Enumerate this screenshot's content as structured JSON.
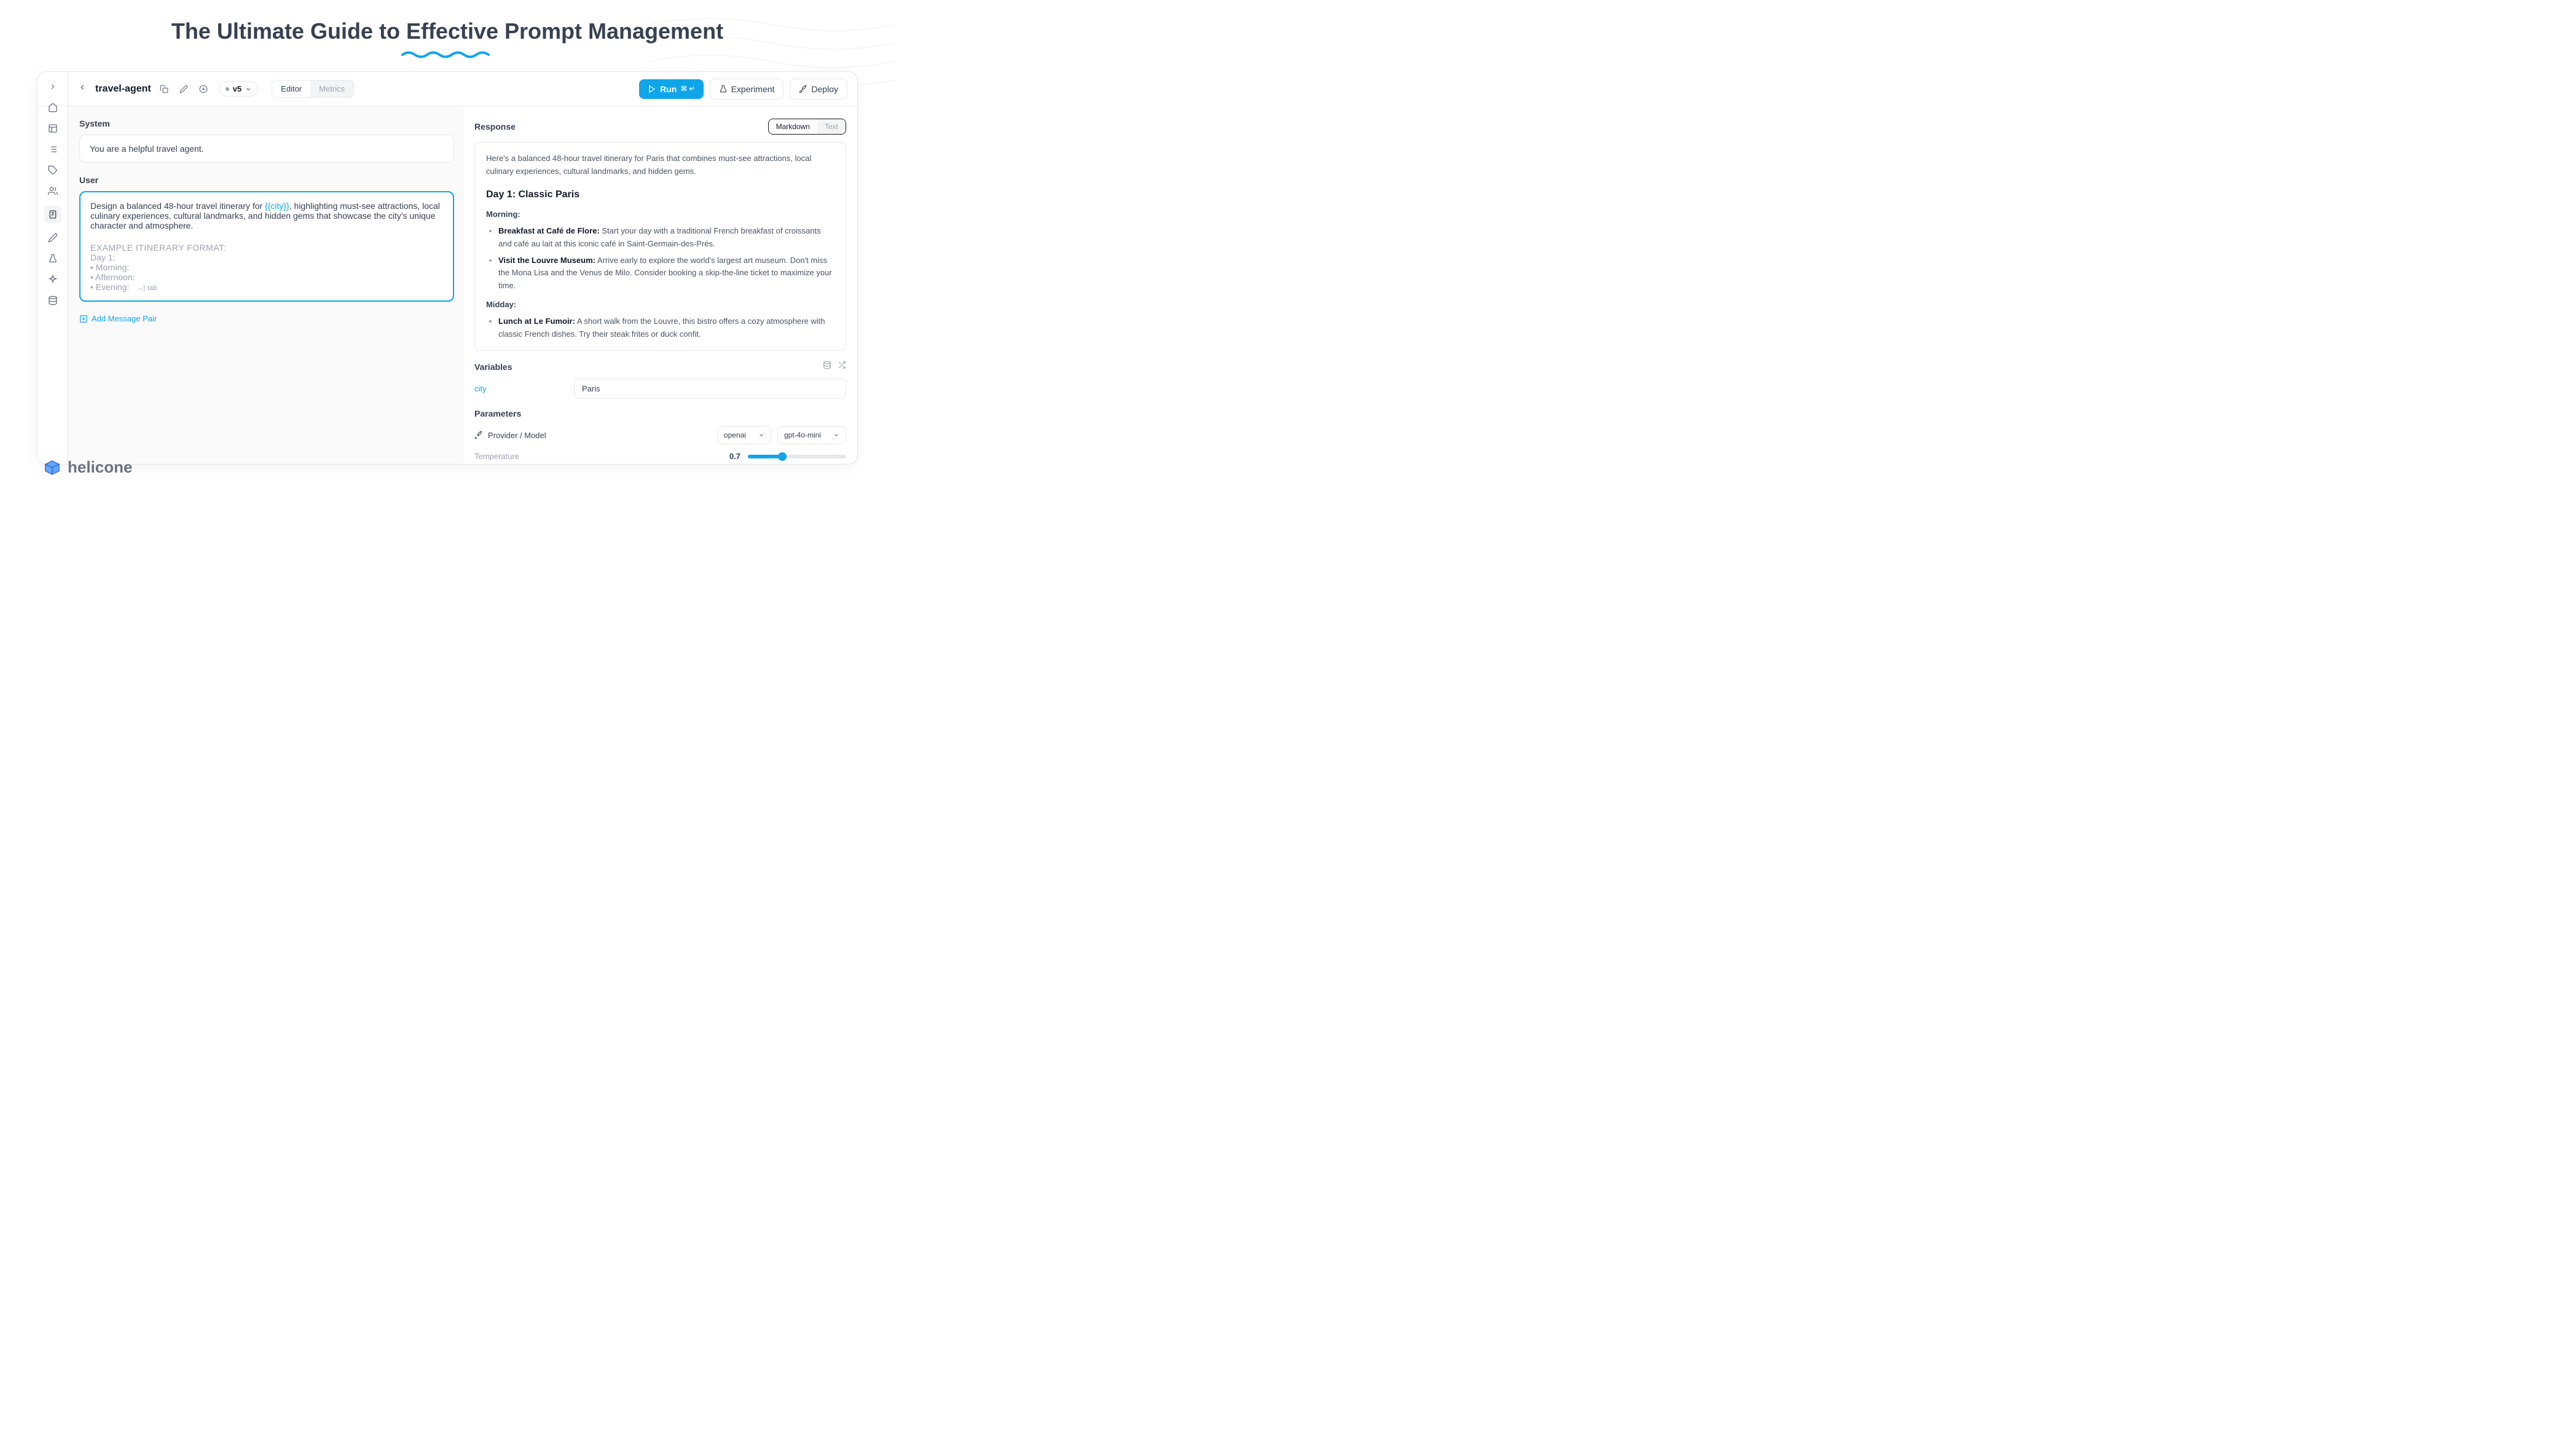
{
  "page": {
    "title": "The Ultimate Guide to Effective Prompt Management"
  },
  "brand": {
    "name": "helicone"
  },
  "topbar": {
    "prompt_name": "travel-agent",
    "version": "v5",
    "tabs": {
      "editor": "Editor",
      "metrics": "Metrics"
    },
    "run": "Run",
    "run_kbd": "⌘ ↵",
    "experiment": "Experiment",
    "deploy": "Deploy"
  },
  "editor": {
    "system_label": "System",
    "system_text": "You are a helpful travel agent.",
    "user_label": "User",
    "user_pre": "Design a balanced 48-hour travel itinerary for ",
    "user_var": "{{city}}",
    "user_post": ", highlighting must-see attractions, local culinary experiences, cultural landmarks, and hidden gems that showcase the city's unique character and atmosphere.",
    "example_heading": "EXAMPLE ITINERARY FORMAT:",
    "example_lines": [
      "Day 1:",
      "• Morning:",
      "• Afternoon:",
      "• Evening:"
    ],
    "tab_hint": "tab",
    "add_pair": "Add Message Pair"
  },
  "response": {
    "label": "Response",
    "toggle": {
      "md": "Markdown",
      "text": "Text"
    },
    "intro": "Here's a balanced 48-hour travel itinerary for Paris that combines must-see attractions, local culinary experiences, cultural landmarks, and hidden gems.",
    "day1_title": "Day 1: Classic Paris",
    "morning_label": "Morning:",
    "item1_bold": "Breakfast at Café de Flore:",
    "item1_text": " Start your day with a traditional French breakfast of croissants and café au lait at this iconic café in Saint-Germain-des-Prés.",
    "item2_bold": "Visit the Louvre Museum:",
    "item2_text": " Arrive early to explore the world's largest art museum. Don't miss the Mona Lisa and the Venus de Milo. Consider booking a skip-the-line ticket to maximize your time.",
    "midday_label": "Midday:",
    "item3_bold": "Lunch at Le Fumoir:",
    "item3_text": " A short walk from the Louvre, this bistro offers a cozy atmosphere with classic French dishes. Try their steak frites or duck confit."
  },
  "variables": {
    "label": "Variables",
    "name": "city",
    "value": "Paris"
  },
  "parameters": {
    "label": "Parameters",
    "provider_label": "Provider / Model",
    "provider": "openai",
    "model": "gpt-4o-mini",
    "temperature_label": "Temperature",
    "temperature": "0.7"
  }
}
